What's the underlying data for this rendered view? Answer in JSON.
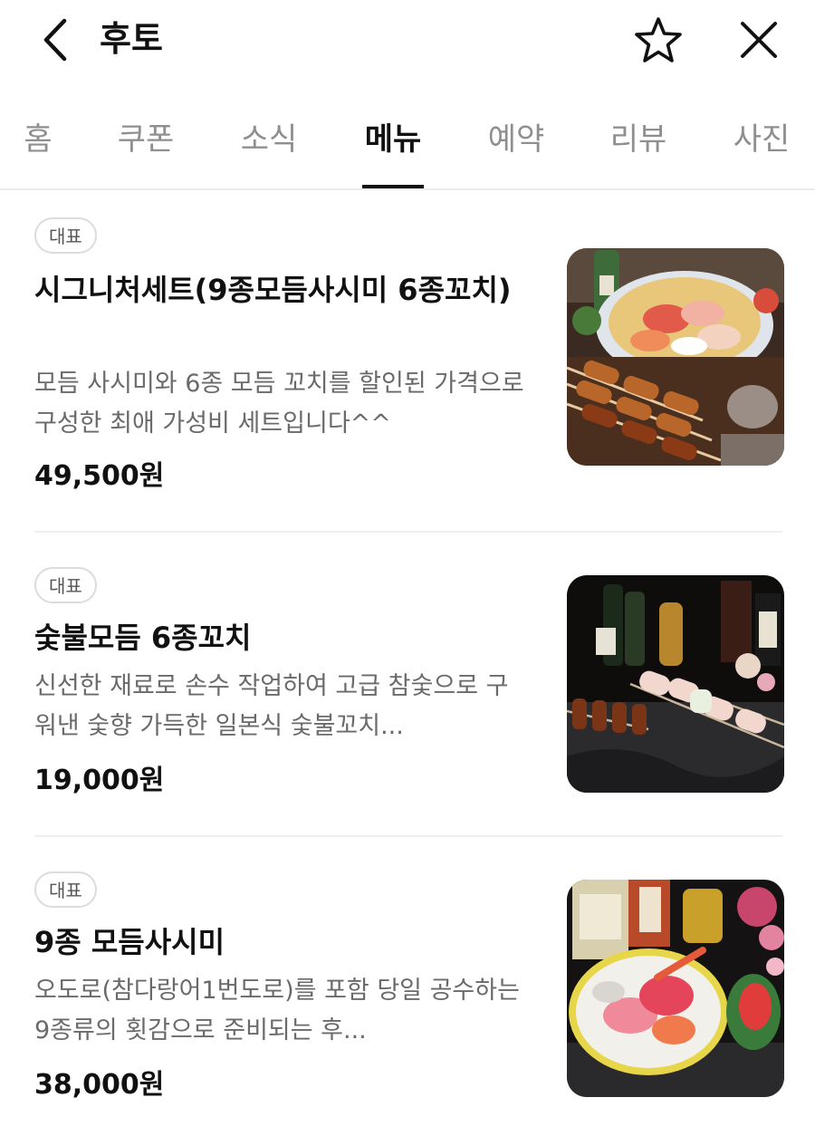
{
  "header": {
    "title": "후토",
    "back_icon": "chevron-left-icon",
    "favorite_icon": "star-outline-icon",
    "close_icon": "close-icon"
  },
  "tabs": [
    {
      "label": "홈",
      "active": false
    },
    {
      "label": "쿠폰",
      "active": false
    },
    {
      "label": "소식",
      "active": false
    },
    {
      "label": "메뉴",
      "active": true
    },
    {
      "label": "예약",
      "active": false
    },
    {
      "label": "리뷰",
      "active": false
    },
    {
      "label": "사진",
      "active": false
    }
  ],
  "menu": {
    "items": [
      {
        "badge": "대표",
        "name": "시그니처세트(9종모듬사시미 6종꼬치)",
        "description": "모듬 사시미와 6종 모듬 꼬치를 할인된 가격으로 구성한 최애 가성비 세트입니다^^",
        "price": "49,500원",
        "image": "sashimi-and-skewers-photo"
      },
      {
        "badge": "대표",
        "name": "숯불모듬 6종꼬치",
        "description": "신선한 재료로 손수 작업하여 고급 참숯으로 구워낸 숯향 가득한 일본식 숯불꼬치...",
        "price": "19,000원",
        "image": "charcoal-skewers-photo"
      },
      {
        "badge": "대표",
        "name": "9종 모듬사시미",
        "description": "오도로(참다랑어1번도로)를 포함 당일 공수하는 9종류의 횟감으로 준비되는 후...",
        "price": "38,000원",
        "image": "sashimi-platter-photo"
      }
    ]
  },
  "colors": {
    "text_primary": "#111111",
    "text_secondary": "#6a6a6a",
    "tab_inactive": "#8f8f8f",
    "divider": "#efefef"
  }
}
